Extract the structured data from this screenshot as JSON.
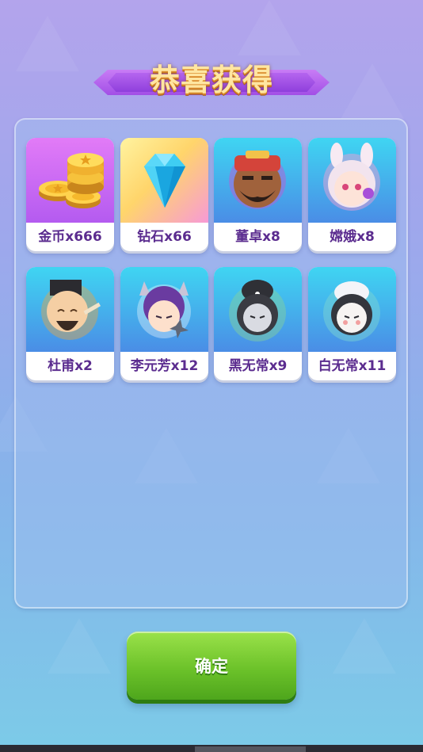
{
  "dialog": {
    "title": "恭喜获得",
    "confirm_label": "确定"
  },
  "rewards": [
    {
      "name": "金币x666",
      "icon": "gold-coins-icon",
      "theme": "purple"
    },
    {
      "name": "钻石x66",
      "icon": "diamond-icon",
      "theme": "yellow"
    },
    {
      "name": "董卓x8",
      "icon": "dongzhuo-avatar-icon",
      "theme": "blue"
    },
    {
      "name": "嫦娥x8",
      "icon": "change-avatar-icon",
      "theme": "blue"
    },
    {
      "name": "杜甫x2",
      "icon": "dufu-avatar-icon",
      "theme": "blue"
    },
    {
      "name": "李元芳x12",
      "icon": "liyuanfang-avatar-icon",
      "theme": "blue"
    },
    {
      "name": "黑无常x9",
      "icon": "heiwuchang-avatar-icon",
      "theme": "blue"
    },
    {
      "name": "白无常x11",
      "icon": "baiwuchang-avatar-icon",
      "theme": "blue"
    }
  ],
  "colors": {
    "label_text": "#5b2c8f",
    "button_green": "#6cc22a",
    "ribbon_purple": "#a24fe6",
    "title_gold": "#ffe6a1"
  }
}
